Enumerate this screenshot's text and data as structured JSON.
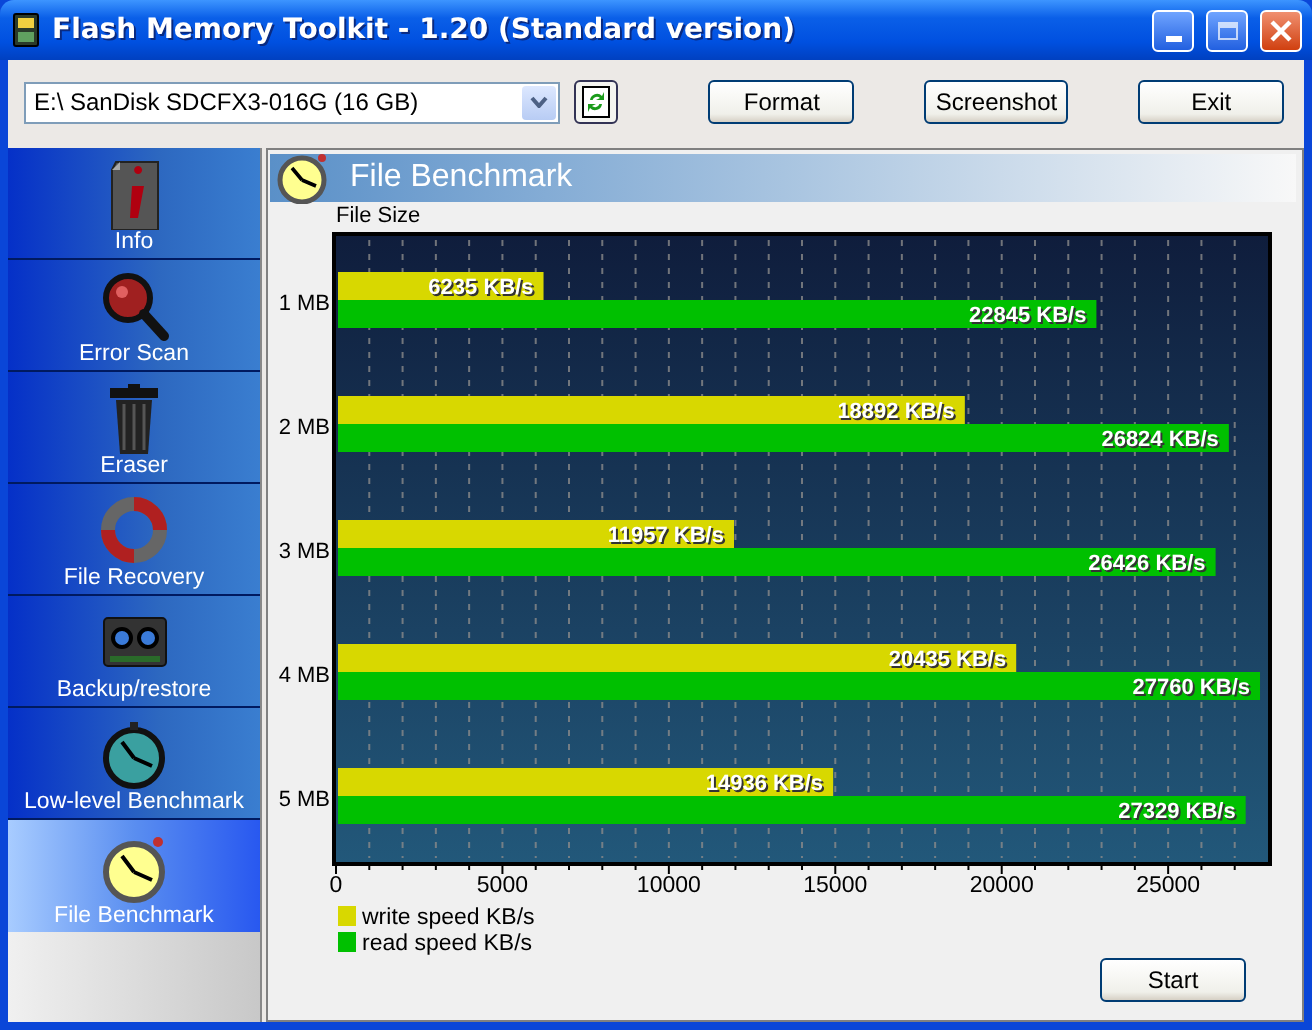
{
  "window": {
    "title": "Flash Memory Toolkit - 1.20 (Standard version)"
  },
  "toolbar": {
    "drive": "E:\\ SanDisk SDCFX3-016G (16 GB)",
    "buttons": [
      "Format",
      "Screenshot",
      "Exit"
    ]
  },
  "sidebar": {
    "items": [
      {
        "label": "Info",
        "selected": false
      },
      {
        "label": "Error Scan",
        "selected": false
      },
      {
        "label": "Eraser",
        "selected": false
      },
      {
        "label": "File Recovery",
        "selected": false
      },
      {
        "label": "Backup/restore",
        "selected": false
      },
      {
        "label": "Low-level Benchmark",
        "selected": false
      },
      {
        "label": "File Benchmark",
        "selected": true
      }
    ]
  },
  "panel": {
    "title": "File Benchmark",
    "chart_data": {
      "type": "bar",
      "orientation": "horizontal",
      "ylabel": "File Size",
      "categories": [
        "1 MB",
        "2 MB",
        "3 MB",
        "4 MB",
        "5 MB"
      ],
      "series": [
        {
          "name": "write speed KB/s",
          "color": "#d8d800",
          "values": [
            6235,
            18892,
            11957,
            20435,
            14936
          ],
          "value_labels": [
            "6235 KB/s",
            "18892 KB/s",
            "11957 KB/s",
            "20435 KB/s",
            "14936 KB/s"
          ]
        },
        {
          "name": "read speed KB/s",
          "color": "#00c000",
          "values": [
            22845,
            26824,
            26426,
            27760,
            27329
          ],
          "value_labels": [
            "22845 KB/s",
            "26824 KB/s",
            "26426 KB/s",
            "27760 KB/s",
            "27329 KB/s"
          ]
        }
      ],
      "xlim": [
        0,
        28000
      ],
      "xticks": [
        0,
        5000,
        10000,
        15000,
        20000,
        25000
      ],
      "grid": true,
      "legend": true
    },
    "start_button": "Start"
  }
}
